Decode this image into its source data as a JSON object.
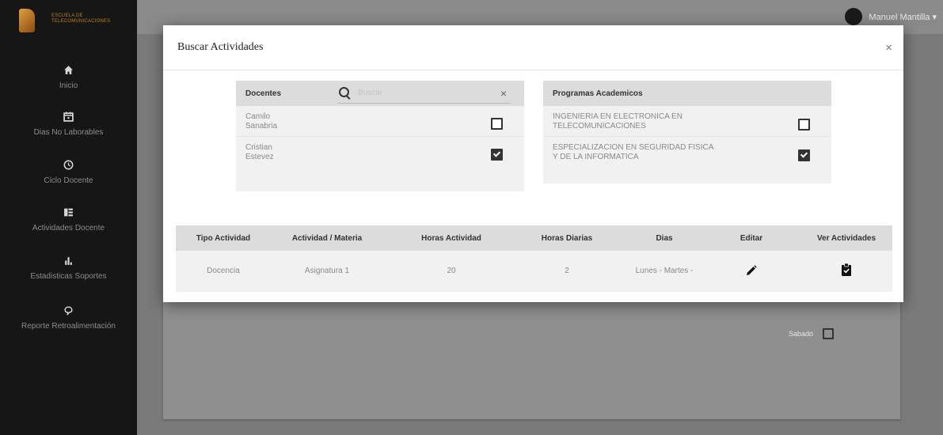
{
  "sidebar": {
    "logo_text": "ESCUELA DE TELECOMUNICACIONES",
    "items": [
      {
        "label": "Inicio",
        "icon": "home-icon"
      },
      {
        "label": "Dias No Laborables",
        "icon": "calendar-icon"
      },
      {
        "label": "Ciclo Docente",
        "icon": "clock-icon"
      },
      {
        "label": "Actividades Docente",
        "icon": "list-icon"
      },
      {
        "label": "Estadisticas Soportes",
        "icon": "bar-chart-icon"
      },
      {
        "label": "Reporte Retroalimentación",
        "icon": "feedback-icon"
      }
    ]
  },
  "header": {
    "user_name": "Manuel Mantilla ▾"
  },
  "background": {
    "sabado_label": "Sabado"
  },
  "modal": {
    "title": "Buscar Actividades",
    "close_label": "×",
    "docentes": {
      "header": "Docentes",
      "search_placeholder": "Buscar",
      "clear_label": "×",
      "rows": [
        {
          "name": "Camilo\nSanabria",
          "checked": false
        },
        {
          "name": "Cristian\nEstevez",
          "checked": true
        }
      ]
    },
    "programas": {
      "header": "Programas Academicos",
      "rows": [
        {
          "name": "INGENIERIA EN ELECTRONICA EN\nTELECOMUNICACIONES",
          "checked": false
        },
        {
          "name": "ESPECIALIZACION EN SEGURIDAD FISICA\nY DE LA INFORMATICA",
          "checked": true
        }
      ]
    },
    "table": {
      "headers": [
        "Tipo Actividad",
        "Actividad / Materia",
        "Horas Actividad",
        "Horas Diarias",
        "Dias",
        "Editar",
        "Ver Actividades"
      ],
      "rows": [
        {
          "tipo": "Docencia",
          "actividad": "Asignatura 1",
          "horas_actividad": "20",
          "horas_diarias": "2",
          "dias": "Lunes - Martes -"
        }
      ]
    }
  }
}
